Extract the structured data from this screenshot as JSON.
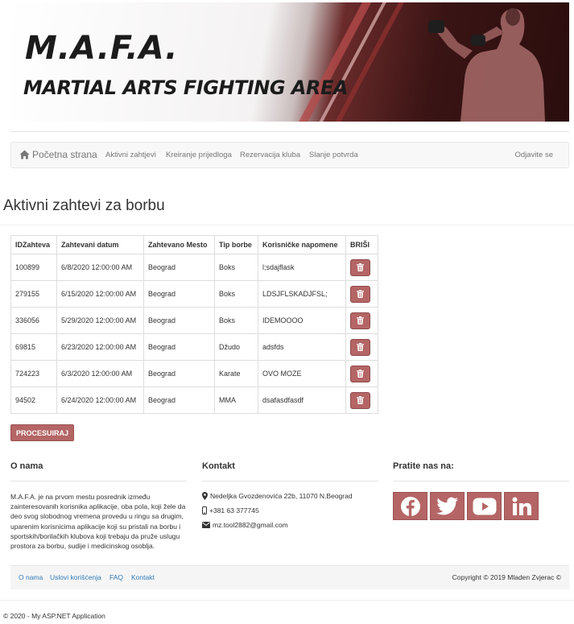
{
  "banner": {
    "title_line1": "M.A.F.A.",
    "title_line2": "MARTIAL ARTS FIGHTING AREA"
  },
  "navbar": {
    "home": "Početna strana",
    "links": [
      "Aktivni zahtjevi",
      "Kreiranje prijedloga",
      "Rezervacija kluba",
      "Slanje potvrda"
    ],
    "logout": "Odjavite se"
  },
  "page_title": "Aktivni zahtevi za borbu",
  "table": {
    "headers": [
      "IDZahteva",
      "Zahtevani datum",
      "Zahtevano Mesto",
      "Tip borbe",
      "Korisničke napomene",
      "BRIŠI"
    ],
    "rows": [
      [
        "100899",
        "6/8/2020 12:00:00 AM",
        "Beograd",
        "Boks",
        "l;sdajflask"
      ],
      [
        "279155",
        "6/15/2020 12:00:00 AM",
        "Beograd",
        "Boks",
        "LDSJFLSKADJFSL;"
      ],
      [
        "336056",
        "5/29/2020 12:00:00 AM",
        "Beograd",
        "Boks",
        "IDEMOOOO"
      ],
      [
        "69815",
        "6/23/2020 12:00:00 AM",
        "Beograd",
        "Džudo",
        "adsfds"
      ],
      [
        "724223",
        "6/3/2020 12:00:00 AM",
        "Beograd",
        "Karate",
        "OVO MOZE"
      ],
      [
        "94502",
        "6/24/2020 12:00:00 AM",
        "Beograd",
        "MMA",
        "dsafasdfasdf"
      ]
    ],
    "delete_icon": "trash-icon"
  },
  "process_button": "PROCESUIRAJ",
  "footer": {
    "about_title": "O nama",
    "about_text": "M.A.F.A. je na prvom mestu posrednik između zainteresovanih korisnika aplikacije, oba pola, koji žele da deo svog slobodnog vremena provedu u ringu sa drugim, uparenim korisnicima aplikacije koji su pristali na borbu i sportskih/borilačkih klubova koji trebaju da pruže uslugu prostora za borbu, sudije i medicinskog osoblja.",
    "contact_title": "Kontakt",
    "address": "Nedeljka Gvozdenovića 22b, 11070 N.Beograd",
    "phone": "+381 63 377745",
    "email": "mz.tool2882@gmail.com",
    "social_title": "Pratite nas na:",
    "social_icons": [
      "facebook-icon",
      "twitter-icon",
      "youtube-icon",
      "linkedin-icon"
    ],
    "bottom_links": [
      "O nama",
      "Uslovi korišćenja",
      "FAQ",
      "Kontakt"
    ],
    "copyright": "Copyright © 2019 Mladen Zvjerac ©"
  },
  "page_footer": "© 2020 - My ASP.NET Application",
  "colors": {
    "accent": "#b56565",
    "link": "#337ab7"
  }
}
